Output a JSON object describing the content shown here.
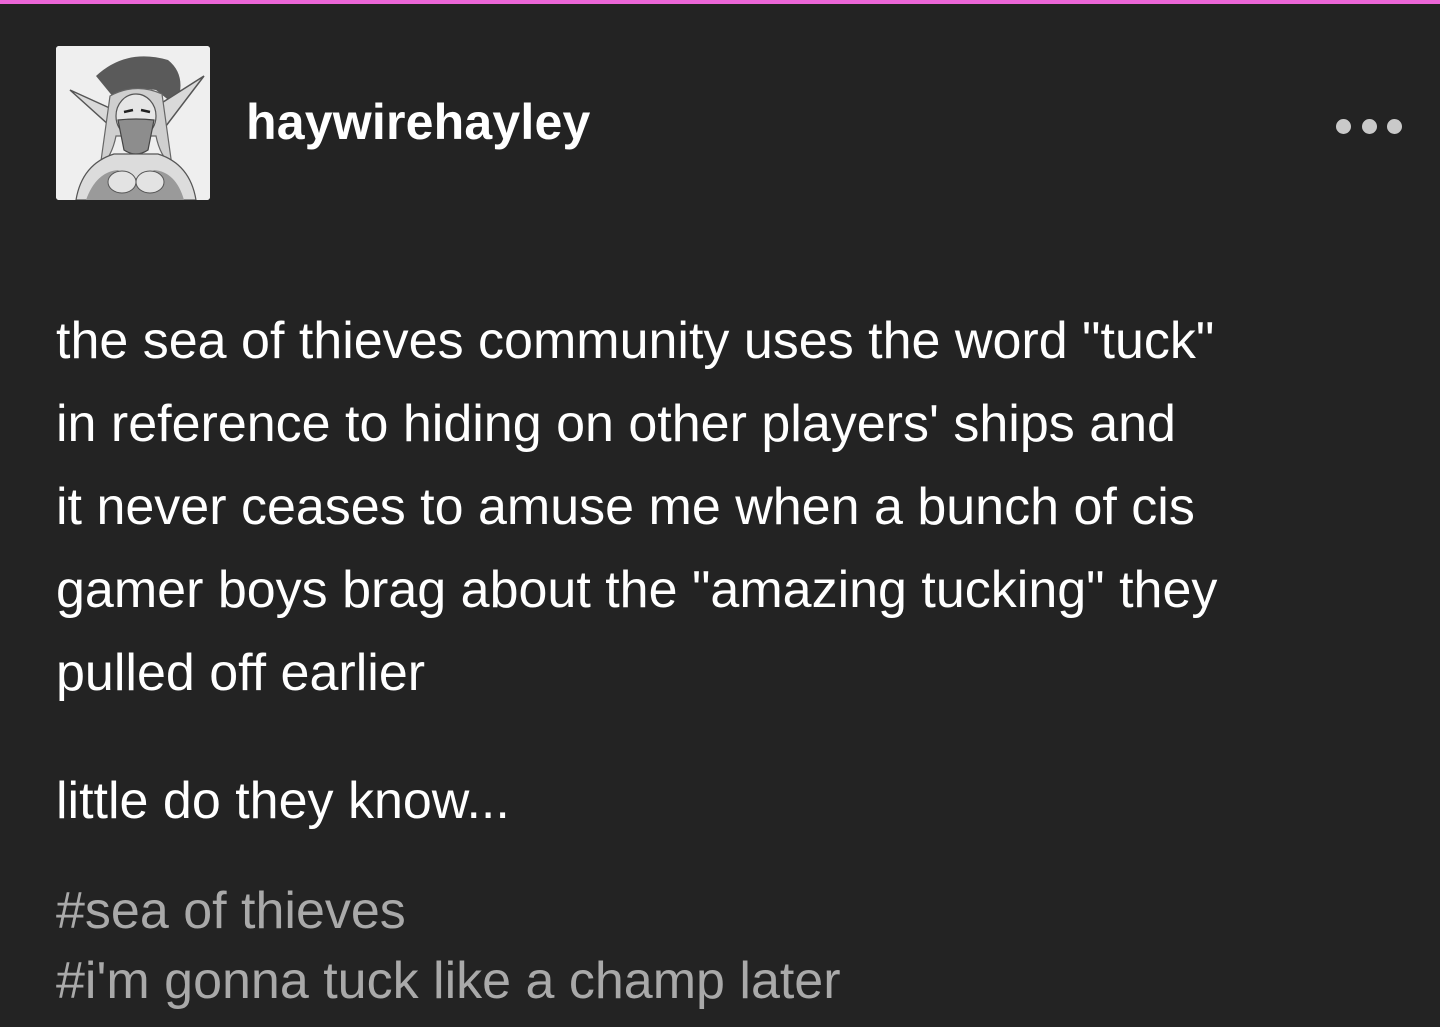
{
  "post": {
    "username": "haywirehayley",
    "avatar_icon": "avatar-elf-portrait",
    "more_icon": "more-dots-icon",
    "body_lines": [
      "the sea of thieves community uses the word \"tuck\"",
      "in reference to hiding on other players' ships and",
      "it never ceases to amuse me when a bunch of cis",
      "gamer boys brag about the \"amazing tucking\" they",
      "pulled off earlier"
    ],
    "body_paragraph_2": "little do they know...",
    "tags": [
      "#sea of thieves",
      "#i'm gonna tuck like a champ later"
    ]
  },
  "colors": {
    "background": "#232323",
    "accent_bar": "#ec66d7",
    "text": "#ffffff",
    "tags": "#a9a9a9"
  }
}
